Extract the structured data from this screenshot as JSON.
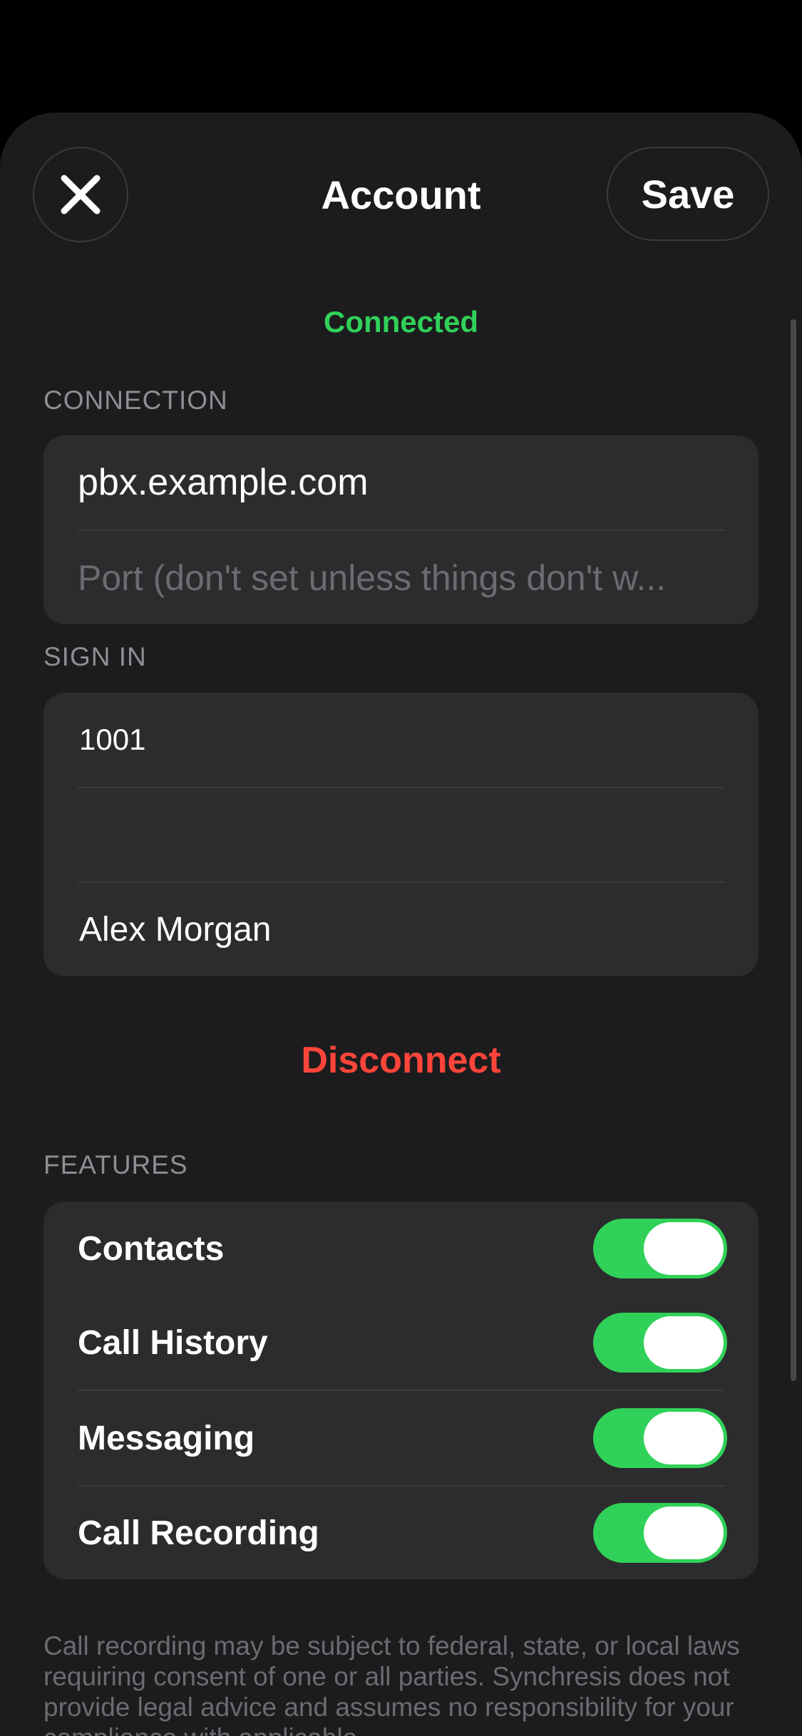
{
  "header": {
    "title": "Account",
    "save_label": "Save",
    "close_icon": "close-icon"
  },
  "status": {
    "text": "Connected",
    "color": "#30d158"
  },
  "connection": {
    "header": "CONNECTION",
    "server_value": "pbx.example.com",
    "port_placeholder": "Port (don't set unless things don't w..."
  },
  "sign_in": {
    "header": "SIGN IN",
    "username_value": "1001",
    "password_value": "",
    "display_name_value": "Alex Morgan"
  },
  "disconnect": {
    "label": "Disconnect",
    "color": "#ff453a"
  },
  "features": {
    "header": "FEATURES",
    "items": [
      {
        "label": "Contacts",
        "enabled": true
      },
      {
        "label": "Call History",
        "enabled": true
      },
      {
        "label": "Messaging",
        "enabled": true
      },
      {
        "label": "Call Recording",
        "enabled": true
      }
    ]
  },
  "footnote": {
    "text": "Call recording may be subject to federal, state, or local laws requiring consent of one or all parties. Synchresis does not provide legal advice and assumes no responsibility for your compliance with applicable"
  },
  "colors": {
    "background": "#1c1c1e",
    "group_background": "#2c2c2e",
    "toggle_on": "#30d158"
  }
}
